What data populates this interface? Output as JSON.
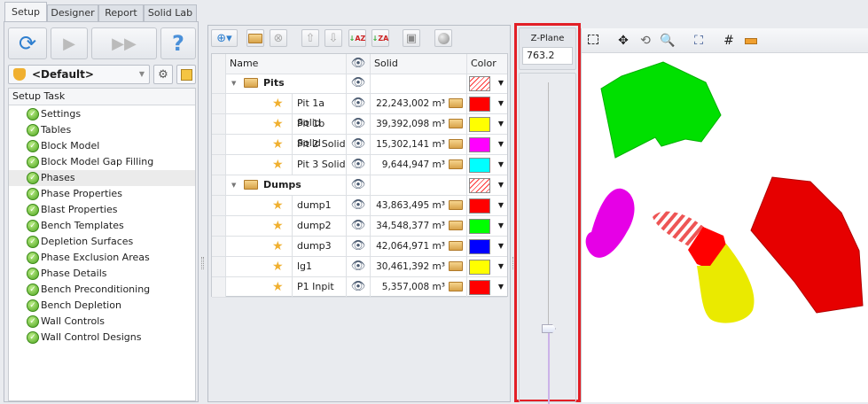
{
  "tabs": [
    "Setup",
    "Designer",
    "Report",
    "Solid Lab"
  ],
  "left": {
    "scenario": "<Default>",
    "task_header": "Setup Task",
    "tasks": [
      "Settings",
      "Tables",
      "Block Model",
      "Block Model Gap Filling",
      "Phases",
      "Phase Properties",
      "Blast Properties",
      "Bench Templates",
      "Depletion Surfaces",
      "Phase Exclusion Areas",
      "Phase Details",
      "Bench Preconditioning",
      "Bench Depletion",
      "Wall Controls",
      "Wall Control Designs"
    ],
    "selected": "Phases"
  },
  "grid": {
    "headers": {
      "name": "Name",
      "solid": "Solid",
      "color": "Color"
    },
    "rows": [
      {
        "group": true,
        "name": "Pits"
      },
      {
        "name": "Pit 1a Solid",
        "solid": "22,243,002 m³",
        "color": "#ff0000"
      },
      {
        "name": "Pit 1b Solid",
        "solid": "39,392,098 m³",
        "color": "#ffff00"
      },
      {
        "name": "Pit 2 Solid",
        "solid": "15,302,141 m³",
        "color": "#ff00ff"
      },
      {
        "name": "Pit 3 Solid",
        "solid": "9,644,947 m³",
        "color": "#00ffff"
      },
      {
        "group": true,
        "name": "Dumps"
      },
      {
        "name": "dump1",
        "solid": "43,863,495 m³",
        "color": "#ff0000"
      },
      {
        "name": "dump2",
        "solid": "34,548,377 m³",
        "color": "#00ff00"
      },
      {
        "name": "dump3",
        "solid": "42,064,971 m³",
        "color": "#0000ff"
      },
      {
        "name": "lg1",
        "solid": "30,461,392 m³",
        "color": "#ffff00"
      },
      {
        "name": "P1 Inpit",
        "solid": "5,357,008 m³",
        "color": "#ff0000"
      }
    ]
  },
  "zplane": {
    "label": "Z-Plane",
    "value": "763.2"
  },
  "highlight_color": "#e21f26"
}
